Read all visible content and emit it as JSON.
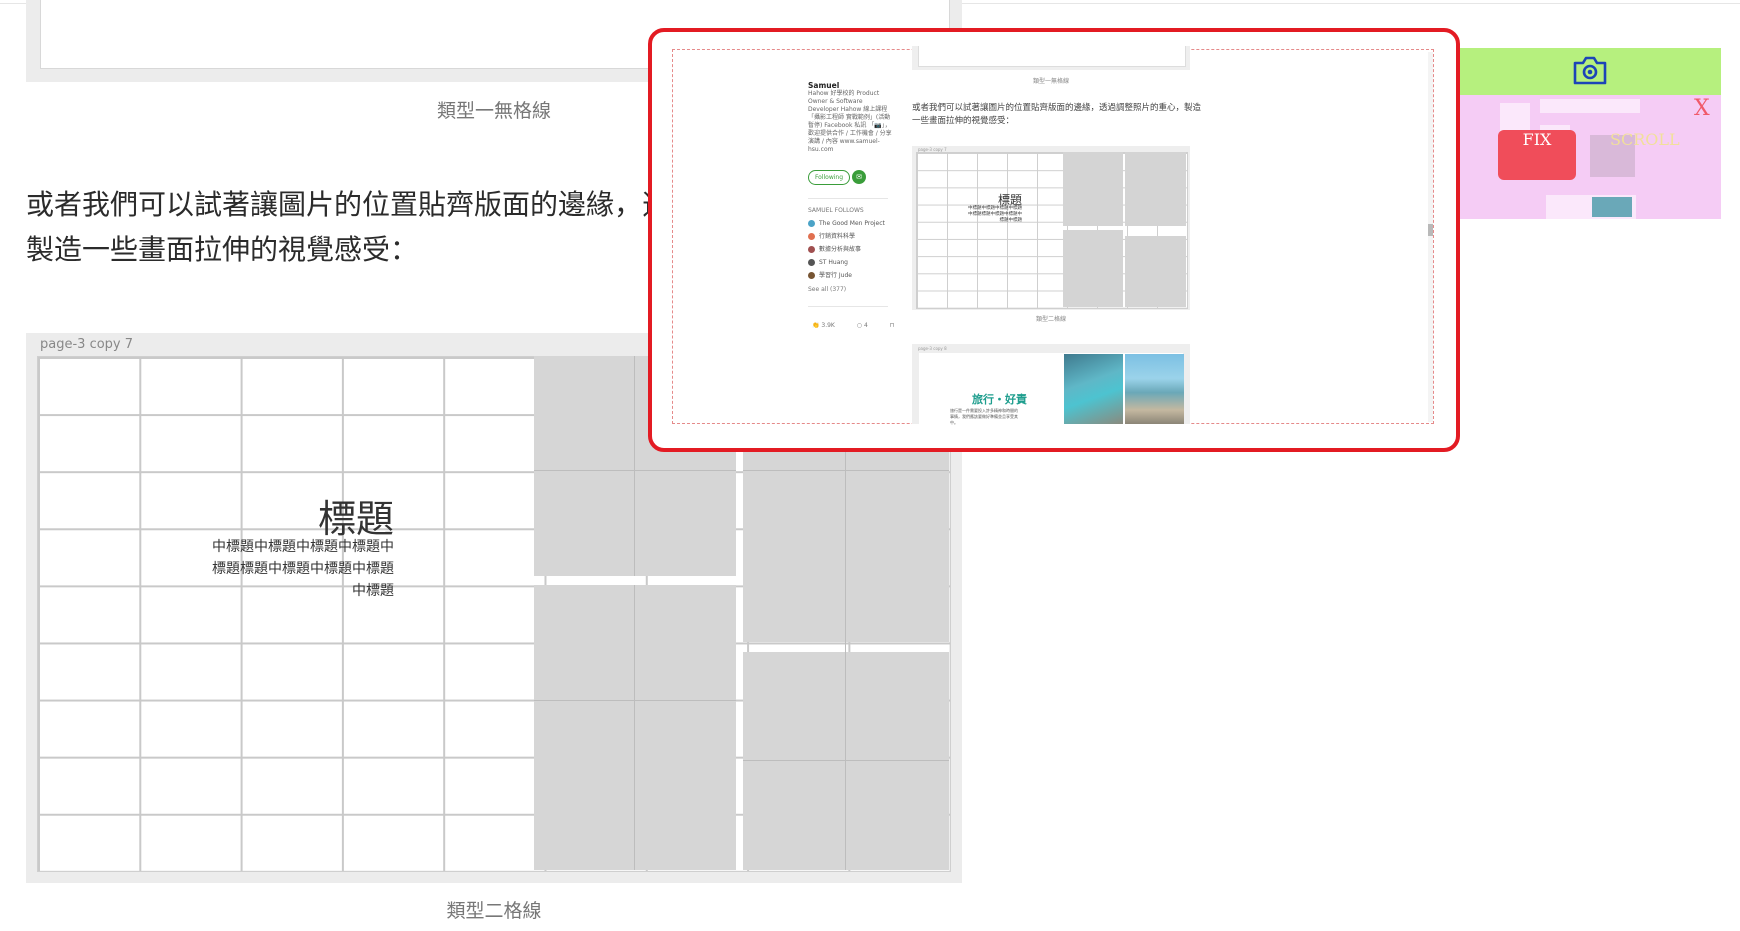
{
  "article": {
    "caption_type1": "類型一無格線",
    "paragraph_line1": "或者我們可以試著讓圖片的位置貼齊版面的邊緣，透",
    "paragraph_line2": "製造一些畫面拉伸的視覺感受：",
    "figure_label": "page-3 copy 7",
    "grid_title": "標題",
    "grid_subtitle_lines": [
      "中標題中標題中標題中標題中",
      "標題標題中標題中標題中標題",
      "中標題"
    ],
    "caption_type2": "類型二格線"
  },
  "screenshot": {
    "author_name": "Samuel",
    "author_bio": "Hahow 好學校的 Product Owner & Software Developer Hahow 線上課程「攝影工程師 實戰範例」(活動暫停) Facebook 私訊 「📷」，歡迎提供合作 / 工作機會 / 分享演講 / 內容 www.samuel-hsu.com",
    "following_label": "Following",
    "follows_title": "SAMUEL FOLLOWS",
    "follows": [
      {
        "name": "The Good Men Project",
        "color": "#4ba3c7"
      },
      {
        "name": "行銷資料科學",
        "color": "#e07050"
      },
      {
        "name": "數據分析與故事",
        "color": "#a05050"
      },
      {
        "name": "ST Huang",
        "color": "#555555"
      },
      {
        "name": "學習行 Jude",
        "color": "#775533"
      }
    ],
    "see_all": "See all (377)",
    "claps": "3.9K",
    "responses": "4",
    "caption_type1": "類型一無格線",
    "paragraph": "或者我們可以試著讓圖片的位置貼齊版面的邊緣，透過調整照片的重心，製造一些畫面拉伸的視覺感受：",
    "figure_label": "page-3 copy 7",
    "grid_title": "標題",
    "grid_subtitle": "中標題中標題中標題中標題中標題標題中標題中標題中標題中標題",
    "caption_type2": "類型二格線",
    "figure3_label": "page-3 copy 8",
    "travel_title": "旅行・好責",
    "travel_text": "旅行是一件需要投入許多精神和時間的事情，我們應該要做好準備並且享受其中。"
  },
  "widget": {
    "camera_icon": "camera-icon",
    "fix_label": "FIX",
    "scroll_label": "SCROLL",
    "close_label": "X",
    "colors": {
      "top": "#b6f07e",
      "panel": "#f5ccf5",
      "fix": "#f04d5a",
      "frame": "#e31b23"
    }
  }
}
